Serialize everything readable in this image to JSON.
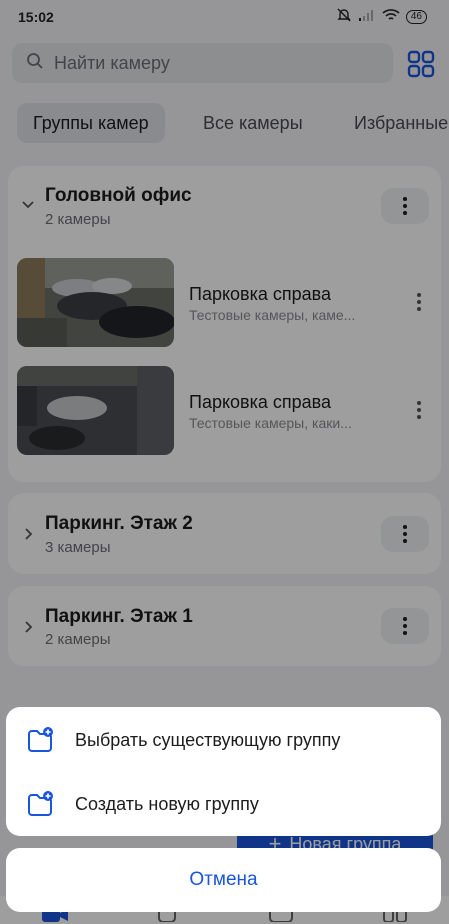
{
  "status_bar": {
    "time": "15:02",
    "battery": "46"
  },
  "search": {
    "placeholder": "Найти камеру"
  },
  "tabs": [
    {
      "label": "Группы камер",
      "active": true
    },
    {
      "label": "Все камеры",
      "active": false
    },
    {
      "label": "Избранные",
      "active": false
    }
  ],
  "groups": [
    {
      "title": "Головной офис",
      "subtitle": "2 камеры",
      "expanded": true,
      "cameras": [
        {
          "title": "Парковка справа",
          "subtitle": "Тестовые камеры, каме..."
        },
        {
          "title": "Парковка справа",
          "subtitle": "Тестовые камеры, каки..."
        }
      ]
    },
    {
      "title": "Паркинг. Этаж 2",
      "subtitle": "3 камеры",
      "expanded": false
    },
    {
      "title": "Паркинг. Этаж 1",
      "subtitle": "2 камеры",
      "expanded": false
    }
  ],
  "new_group_button": {
    "label": "Новая группа"
  },
  "action_sheet": {
    "options": [
      {
        "label": "Выбрать существующую группу",
        "icon": "folder-add-icon"
      },
      {
        "label": "Создать новую группу",
        "icon": "folder-add-icon"
      }
    ],
    "cancel_label": "Отмена"
  },
  "colors": {
    "accent": "#1a56db",
    "background": "#f2f3f5",
    "overlay": "rgba(0,0,0,0.38)"
  }
}
